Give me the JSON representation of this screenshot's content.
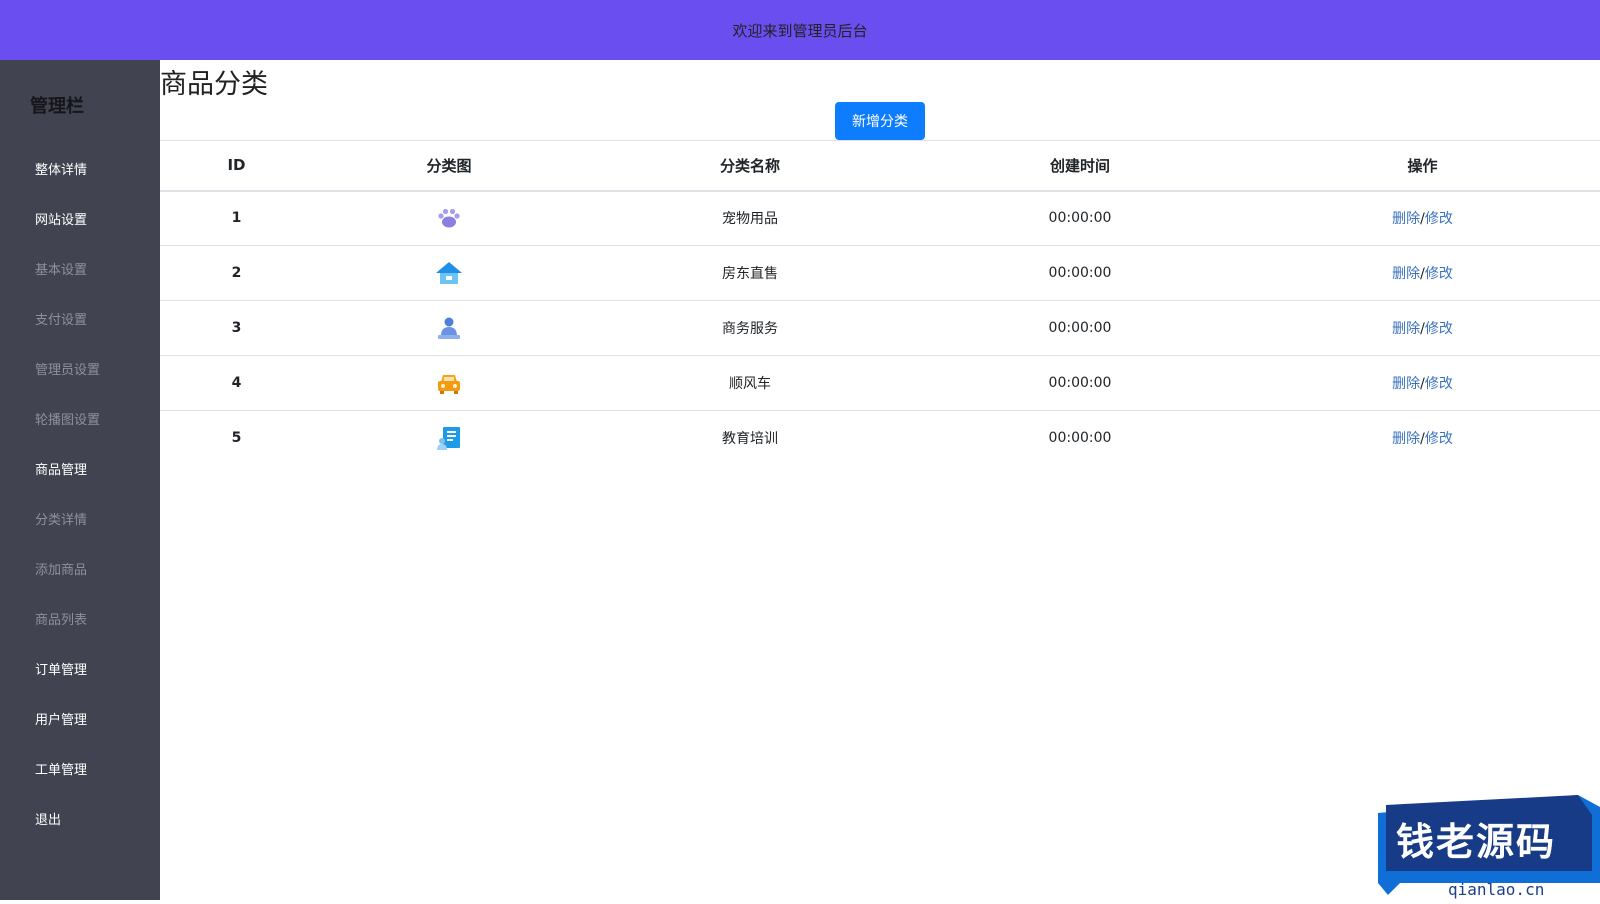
{
  "header": {
    "title": "欢迎来到管理员后台"
  },
  "colors": {
    "header_bg": "#6b4ef0",
    "sidebar_bg": "#414450",
    "primary_button": "#0d7dfd",
    "link": "#3a72c0"
  },
  "sidebar": {
    "title": "管理栏",
    "items": [
      {
        "label": "整体详情",
        "style": "bright"
      },
      {
        "label": "网站设置",
        "style": "bright"
      },
      {
        "label": "基本设置",
        "style": "dim"
      },
      {
        "label": "支付设置",
        "style": "dim"
      },
      {
        "label": "管理员设置",
        "style": "dim"
      },
      {
        "label": "轮播图设置",
        "style": "dim"
      },
      {
        "label": "商品管理",
        "style": "bright"
      },
      {
        "label": "分类详情",
        "style": "dim"
      },
      {
        "label": "添加商品",
        "style": "dim"
      },
      {
        "label": "商品列表",
        "style": "dim"
      },
      {
        "label": "订单管理",
        "style": "bright"
      },
      {
        "label": "用户管理",
        "style": "bright"
      },
      {
        "label": "工单管理",
        "style": "bright"
      },
      {
        "label": "退出",
        "style": "bright"
      }
    ]
  },
  "main": {
    "title": "商品分类",
    "add_button": "新增分类",
    "table": {
      "headers": [
        "ID",
        "分类图",
        "分类名称",
        "创建时间",
        "操作"
      ],
      "rows": [
        {
          "id": "1",
          "icon": "paw-icon",
          "name": "宠物用品",
          "time": "00:00:00",
          "delete": "删除",
          "sep": "/",
          "edit": "修改"
        },
        {
          "id": "2",
          "icon": "house-icon",
          "name": "房东直售",
          "time": "00:00:00",
          "delete": "删除",
          "sep": "/",
          "edit": "修改"
        },
        {
          "id": "3",
          "icon": "business-person-icon",
          "name": "商务服务",
          "time": "00:00:00",
          "delete": "删除",
          "sep": "/",
          "edit": "修改"
        },
        {
          "id": "4",
          "icon": "car-icon",
          "name": "顺风车",
          "time": "00:00:00",
          "delete": "删除",
          "sep": "/",
          "edit": "修改"
        },
        {
          "id": "5",
          "icon": "education-icon",
          "name": "教育培训",
          "time": "00:00:00",
          "delete": "删除",
          "sep": "/",
          "edit": "修改"
        }
      ]
    }
  },
  "watermark": {
    "text": "钱老源码",
    "url": "qianlao.cn"
  }
}
